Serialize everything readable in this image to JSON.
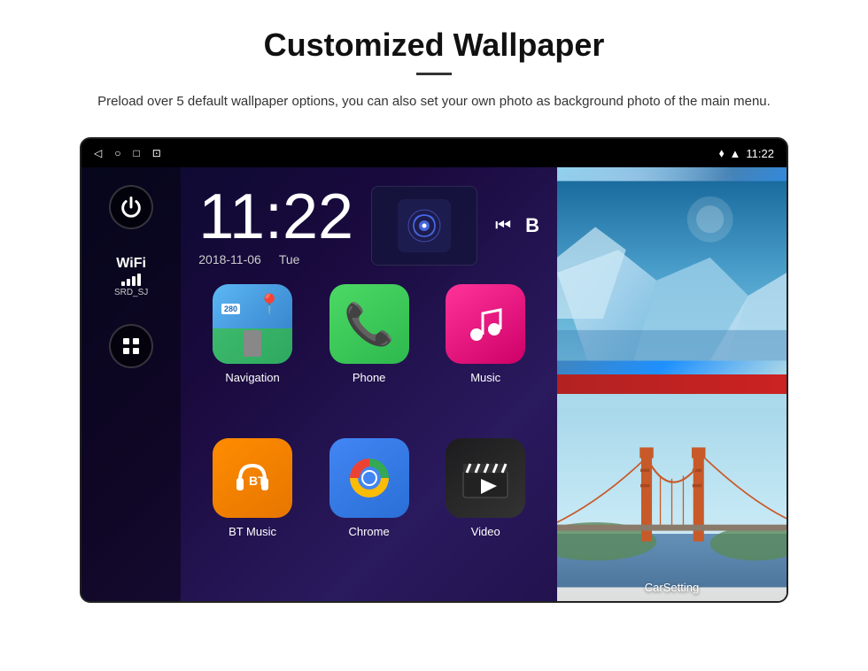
{
  "page": {
    "title": "Customized Wallpaper",
    "description": "Preload over 5 default wallpaper options, you can also set your own photo as background photo of the main menu."
  },
  "status_bar": {
    "time": "11:22",
    "back_icon": "◁",
    "home_icon": "○",
    "recent_icon": "□",
    "screenshot_icon": "⊡"
  },
  "clock": {
    "time": "11:22",
    "date": "2018-11-06",
    "day": "Tue"
  },
  "wifi": {
    "label": "WiFi",
    "network": "SRD_SJ"
  },
  "apps": [
    {
      "id": "navigation",
      "label": "Navigation",
      "road_number": "280"
    },
    {
      "id": "phone",
      "label": "Phone"
    },
    {
      "id": "music",
      "label": "Music"
    },
    {
      "id": "bt_music",
      "label": "BT Music"
    },
    {
      "id": "chrome",
      "label": "Chrome"
    },
    {
      "id": "video",
      "label": "Video"
    }
  ],
  "wallpaper": {
    "car_setting_label": "CarSetting"
  }
}
